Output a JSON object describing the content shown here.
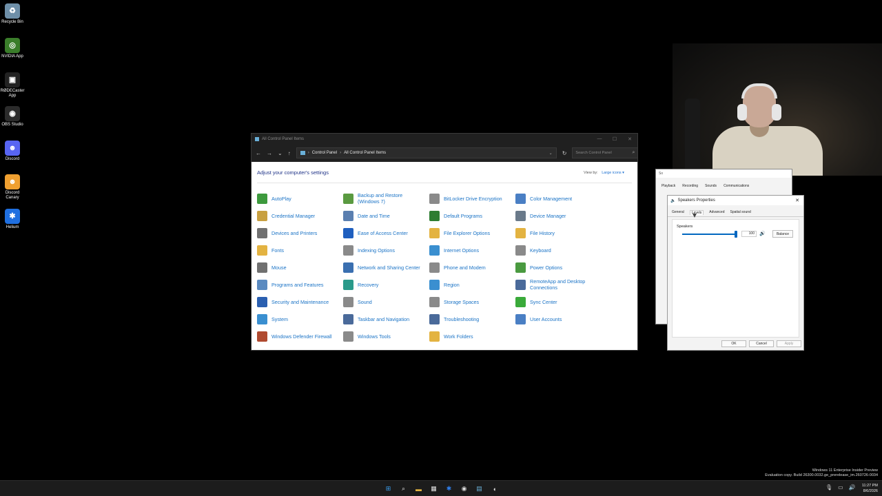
{
  "desktop": {
    "icons": [
      {
        "label": "Recycle Bin",
        "glyph": "♻",
        "color": "#6e8fa8"
      },
      {
        "label": "NVIDIA App",
        "glyph": "◎",
        "color": "#3a7d2a"
      },
      {
        "label": "RØDECaster App",
        "glyph": "▣",
        "color": "#222222"
      },
      {
        "label": "OBS Studio",
        "glyph": "◉",
        "color": "#2b2b2b"
      },
      {
        "label": "Discord",
        "glyph": "☻",
        "color": "#5865f2"
      },
      {
        "label": "Discord Canary",
        "glyph": "☻",
        "color": "#f0a030"
      },
      {
        "label": "Helium",
        "glyph": "✱",
        "color": "#1f6fe0"
      }
    ]
  },
  "control_panel": {
    "title": "All Control Panel Items",
    "address": {
      "root": "Control Panel",
      "current": "All Control Panel Items"
    },
    "search_placeholder": "Search Control Panel",
    "heading": "Adjust your computer's settings",
    "view_by_label": "View by:",
    "view_by_value": "Large icons ▾",
    "items": [
      {
        "label": "AutoPlay",
        "color": "#3d9a3d"
      },
      {
        "label": "Backup and Restore (Windows 7)",
        "color": "#5a9a40"
      },
      {
        "label": "BitLocker Drive Encryption",
        "color": "#8a8a8a"
      },
      {
        "label": "Color Management",
        "color": "#4a7fc4"
      },
      {
        "label": "Credential Manager",
        "color": "#c8a040"
      },
      {
        "label": "Date and Time",
        "color": "#5a7fb0"
      },
      {
        "label": "Default Programs",
        "color": "#2e7d32"
      },
      {
        "label": "Device Manager",
        "color": "#6a7a8a"
      },
      {
        "label": "Devices and Printers",
        "color": "#707070"
      },
      {
        "label": "Ease of Access Center",
        "color": "#1f5fbf"
      },
      {
        "label": "File Explorer Options",
        "color": "#e3b341"
      },
      {
        "label": "File History",
        "color": "#e3b341"
      },
      {
        "label": "Fonts",
        "color": "#e3b341"
      },
      {
        "label": "Indexing Options",
        "color": "#8a8a8a"
      },
      {
        "label": "Internet Options",
        "color": "#3a8fd0"
      },
      {
        "label": "Keyboard",
        "color": "#8a8a8a"
      },
      {
        "label": "Mouse",
        "color": "#707070"
      },
      {
        "label": "Network and Sharing Center",
        "color": "#3a6fb0"
      },
      {
        "label": "Phone and Modem",
        "color": "#8a8a8a"
      },
      {
        "label": "Power Options",
        "color": "#4a9a40"
      },
      {
        "label": "Programs and Features",
        "color": "#5a8ac0"
      },
      {
        "label": "Recovery",
        "color": "#2a9a8a"
      },
      {
        "label": "Region",
        "color": "#3a8fd0"
      },
      {
        "label": "RemoteApp and Desktop Connections",
        "color": "#4a6a9a"
      },
      {
        "label": "Security and Maintenance",
        "color": "#2a5fb0"
      },
      {
        "label": "Sound",
        "color": "#8a8a8a"
      },
      {
        "label": "Storage Spaces",
        "color": "#8a8a8a"
      },
      {
        "label": "Sync Center",
        "color": "#3aaa3a"
      },
      {
        "label": "System",
        "color": "#3a8fd0"
      },
      {
        "label": "Taskbar and Navigation",
        "color": "#4a6a9a"
      },
      {
        "label": "Troubleshooting",
        "color": "#4a6a9a"
      },
      {
        "label": "User Accounts",
        "color": "#4a7fc4"
      },
      {
        "label": "Windows Defender Firewall",
        "color": "#b04a30"
      },
      {
        "label": "Windows Tools",
        "color": "#8a8a8a"
      },
      {
        "label": "Work Folders",
        "color": "#e3b341"
      }
    ]
  },
  "sound_window": {
    "title": "So",
    "tabs": [
      "Playback",
      "Recording",
      "Sounds",
      "Communications"
    ]
  },
  "speakers_properties": {
    "title": "Speakers Properties",
    "tabs": [
      "General",
      "Levels",
      "Advanced",
      "Spatial sound"
    ],
    "active_tab": "Levels",
    "device_label": "Speakers",
    "volume": "100",
    "volume_level": 1.0,
    "balance_label": "Balance",
    "ok_label": "OK",
    "cancel_label": "Cancel",
    "apply_label": "Apply"
  },
  "taskbar": {
    "icons": [
      {
        "name": "start-icon",
        "glyph": "⊞",
        "color": "#3a9ff0"
      },
      {
        "name": "search-icon",
        "glyph": "⌕",
        "color": "#e0e0e0"
      },
      {
        "name": "file-explorer-icon",
        "glyph": "▬",
        "color": "#e3b341"
      },
      {
        "name": "calendar-icon",
        "glyph": "▦",
        "color": "#e0e0e0"
      },
      {
        "name": "helium-icon",
        "glyph": "✱",
        "color": "#2f7de8"
      },
      {
        "name": "obs-icon",
        "glyph": "◉",
        "color": "#dddddd"
      },
      {
        "name": "control-panel-icon",
        "glyph": "▤",
        "color": "#6ab0d8"
      },
      {
        "name": "mouse-icon",
        "glyph": "◖",
        "color": "#dddddd"
      }
    ],
    "time": "11:27 PM",
    "date": "8/6/2026"
  },
  "watermark": {
    "line1": "Windows 11 Enterprise Insider Preview",
    "line2": "Evaluation copy. Build 26300.0032.ge_prerelease_im.260726-0034"
  }
}
